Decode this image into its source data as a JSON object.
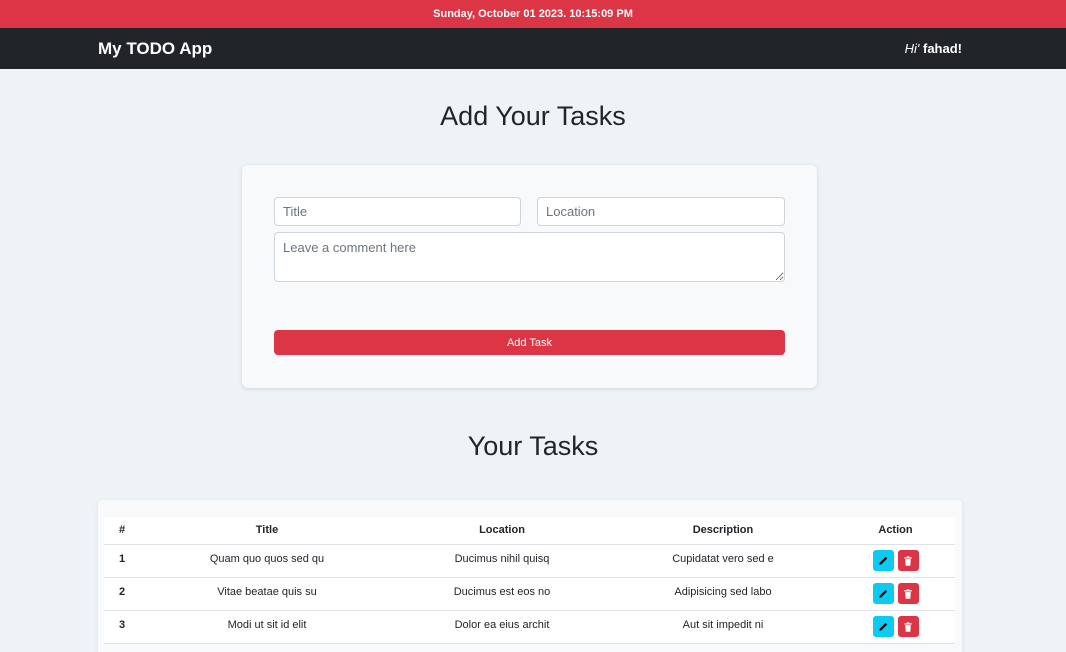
{
  "datebar": {
    "text": "Sunday, October 01 2023. 10:15:09 PM"
  },
  "navbar": {
    "brand": "My TODO App",
    "greeting_hi": "Hi'",
    "username": "fahad!"
  },
  "form": {
    "heading": "Add Your Tasks",
    "title_placeholder": "Title",
    "location_placeholder": "Location",
    "comment_placeholder": "Leave a comment here",
    "submit_label": "Add Task"
  },
  "tasks": {
    "heading": "Your Tasks",
    "columns": [
      "#",
      "Title",
      "Location",
      "Description",
      "Action"
    ],
    "rows": [
      {
        "num": "1",
        "title": "Quam quo quos sed qu",
        "location": "Ducimus nihil quisq",
        "description": "Cupidatat vero sed e"
      },
      {
        "num": "2",
        "title": "Vitae beatae quis su",
        "location": "Ducimus est eos no",
        "description": "Adipisicing sed labo"
      },
      {
        "num": "3",
        "title": "Modi ut sit id elit",
        "location": "Dolor ea eius archit",
        "description": "Aut sit impedit ni"
      }
    ],
    "edit_icon": "pencil-icon",
    "delete_icon": "trash-icon"
  },
  "colors": {
    "accent": "#dc3545",
    "navbar": "#212529",
    "info": "#0dcaf0",
    "background": "#eef3f8"
  }
}
